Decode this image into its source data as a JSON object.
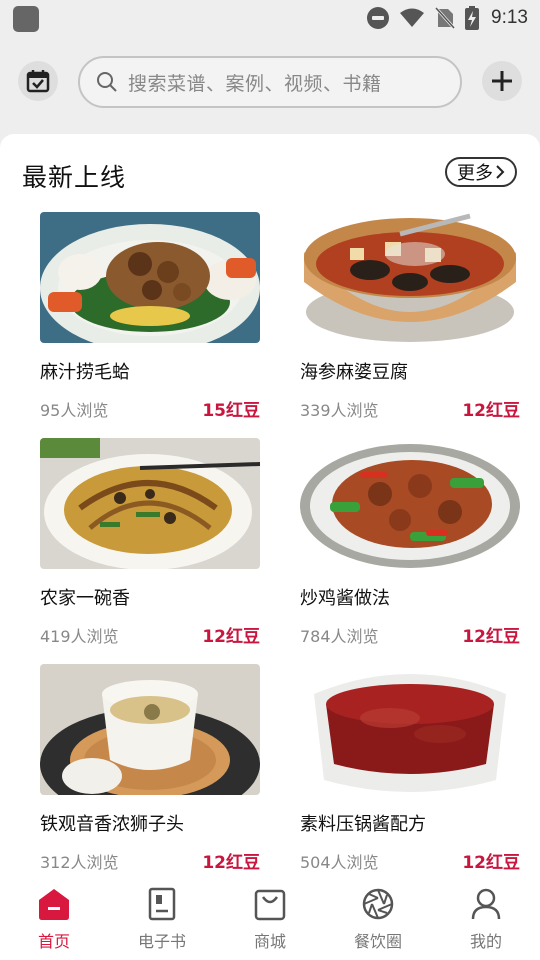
{
  "status_bar": {
    "time": "9:13"
  },
  "header": {
    "search_placeholder": "搜索菜谱、案例、视频、书籍"
  },
  "section": {
    "title": "最新上线",
    "more_label": "更多"
  },
  "recipes": [
    {
      "title": "麻汁捞毛蛤",
      "views": "95人浏览",
      "price": "15红豆"
    },
    {
      "title": "海参麻婆豆腐",
      "views": "339人浏览",
      "price": "12红豆"
    },
    {
      "title": "农家一碗香",
      "views": "419人浏览",
      "price": "12红豆"
    },
    {
      "title": "炒鸡酱做法",
      "views": "784人浏览",
      "price": "12红豆"
    },
    {
      "title": "铁观音香浓狮子头",
      "views": "312人浏览",
      "price": "12红豆"
    },
    {
      "title": "素料压锅酱配方",
      "views": "504人浏览",
      "price": "12红豆"
    }
  ],
  "bottom_nav": [
    {
      "label": "首页",
      "icon": "home-icon",
      "active": true
    },
    {
      "label": "电子书",
      "icon": "ebook-icon",
      "active": false
    },
    {
      "label": "商城",
      "icon": "shopping-bag-icon",
      "active": false
    },
    {
      "label": "餐饮圈",
      "icon": "aperture-icon",
      "active": false
    },
    {
      "label": "我的",
      "icon": "user-icon",
      "active": false
    }
  ],
  "colors": {
    "accent": "#d8183e",
    "price": "#c8163f",
    "background": "#eeeeee"
  }
}
